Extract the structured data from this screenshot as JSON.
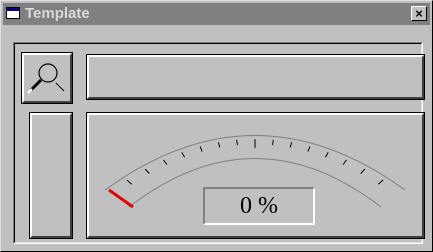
{
  "window": {
    "title": "Template",
    "close_label": "×"
  },
  "gauge": {
    "value_percent": 0,
    "readout": "0 %",
    "needle_color": "#e00000",
    "tick_count": 15
  },
  "icons": {
    "search": "search-icon"
  }
}
